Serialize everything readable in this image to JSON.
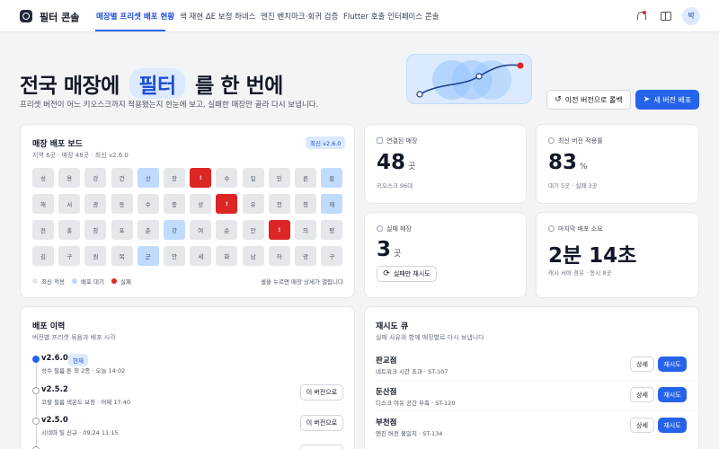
{
  "app": {
    "title": "필터 콘솔"
  },
  "nav": {
    "tabs": [
      {
        "label": "매장별 프리셋 배포 현황"
      },
      {
        "label": "색 재현 ΔE 보정 하네스"
      },
      {
        "label": "엔진 벤치마크·회귀 검증"
      },
      {
        "label": "Flutter 호출 인터페이스 콘솔"
      }
    ],
    "active_tab": 0,
    "avatar": "박"
  },
  "hero": {
    "title_before": "전국 매장에",
    "title_highlight": "필터",
    "title_after": "를 한 번에",
    "subtitle": "프리셋 버전이 어느 키오스크까지 적용됐는지 한눈에 보고, 실패한 매장만 골라 다시 보냅니다.",
    "rollback_label": "이전 버전으로 롤백",
    "deploy_label": "새 버전 배포"
  },
  "board": {
    "title": "매장 배포 보드",
    "badge": "최신 v2.6.0",
    "subtitle": "지역 6곳 · 매장 48곳 · 최신 v2.6.0",
    "rows": [
      [
        {
          "t": "성",
          "s": "latest"
        },
        {
          "t": "용",
          "s": "latest"
        },
        {
          "t": "강",
          "s": "latest"
        },
        {
          "t": "건",
          "s": "latest"
        },
        {
          "t": "산",
          "s": "waiting"
        },
        {
          "t": "장",
          "s": "latest"
        },
        {
          "t": "!",
          "s": "failed"
        },
        {
          "t": "수",
          "s": "latest"
        },
        {
          "t": "일",
          "s": "latest"
        },
        {
          "t": "인",
          "s": "latest"
        },
        {
          "t": "론",
          "s": "latest"
        },
        {
          "t": "릉",
          "s": "waiting"
        }
      ],
      [
        {
          "t": "해",
          "s": "latest"
        },
        {
          "t": "서",
          "s": "latest"
        },
        {
          "t": "광",
          "s": "latest"
        },
        {
          "t": "동",
          "s": "latest"
        },
        {
          "t": "수",
          "s": "latest"
        },
        {
          "t": "충",
          "s": "latest"
        },
        {
          "t": "상",
          "s": "latest"
        },
        {
          "t": "!",
          "s": "failed"
        },
        {
          "t": "유",
          "s": "latest"
        },
        {
          "t": "천",
          "s": "latest"
        },
        {
          "t": "청",
          "s": "latest"
        },
        {
          "t": "제",
          "s": "waiting"
        }
      ],
      [
        {
          "t": "전",
          "s": "latest"
        },
        {
          "t": "홍",
          "s": "latest"
        },
        {
          "t": "창",
          "s": "latest"
        },
        {
          "t": "포",
          "s": "latest"
        },
        {
          "t": "춘",
          "s": "latest"
        },
        {
          "t": "강",
          "s": "waiting"
        },
        {
          "t": "여",
          "s": "latest"
        },
        {
          "t": "순",
          "s": "latest"
        },
        {
          "t": "안",
          "s": "latest"
        },
        {
          "t": "!",
          "s": "failed"
        },
        {
          "t": "의",
          "s": "latest"
        },
        {
          "t": "평",
          "s": "latest"
        }
      ],
      [
        {
          "t": "김",
          "s": "latest"
        },
        {
          "t": "구",
          "s": "latest"
        },
        {
          "t": "원",
          "s": "latest"
        },
        {
          "t": "목",
          "s": "latest"
        },
        {
          "t": "군",
          "s": "waiting"
        },
        {
          "t": "안",
          "s": "latest"
        },
        {
          "t": "세",
          "s": "latest"
        },
        {
          "t": "화",
          "s": "latest"
        },
        {
          "t": "남",
          "s": "latest"
        },
        {
          "t": "하",
          "s": "latest"
        },
        {
          "t": "광",
          "s": "latest"
        },
        {
          "t": "구",
          "s": "latest"
        }
      ]
    ],
    "legend": {
      "latest": "최신 적용",
      "waiting": "배포 대기",
      "failed": "실패"
    },
    "hint": "셀을 누르면 매장 상세가 열립니다",
    "colors": {
      "latest": "#e5e7eb",
      "waiting": "#bfdbfe",
      "failed": "#dc2626"
    }
  },
  "stats": {
    "connected": {
      "label": "연결된 매장",
      "value": "48",
      "unit": "곳",
      "note": "키오스크 96대"
    },
    "latest_rate": {
      "label": "최신 버전 적용률",
      "value": "83",
      "unit": "%",
      "note": "대기 5곳 · 실패 3곳"
    },
    "failed": {
      "label": "실패 매장",
      "value": "3",
      "unit": "곳",
      "retry_label": "실패만 재시도"
    },
    "duration": {
      "label": "마지막 배포 소요",
      "value": "2분 14초",
      "note": "캐시 서버 경유 · 동시 8곳"
    }
  },
  "history": {
    "title": "배포 이력",
    "subtitle": "버전별 프리셋 묶음과 배포 시각",
    "items": [
      {
        "version": "v2.6.0",
        "badge": "현재",
        "note": "성수 필름 톤 외 2종 · 오늘 14:02"
      },
      {
        "version": "v2.5.2",
        "note": "코랄 필름 색온도 보정 · 어제 17:40",
        "action": "이 버전으로"
      },
      {
        "version": "v2.5.0",
        "note": "시네마 틸 신규 · 09.24 11:15",
        "action": "이 버전으로"
      }
    ]
  },
  "queue": {
    "title": "재시도 큐",
    "subtitle": "실패 사유와 함께 매장별로 다시 보냅니다",
    "detail_label": "상세",
    "retry_label": "재시도",
    "items": [
      {
        "name": "판교점",
        "reason": "네트워크 시간 초과 · ST-107"
      },
      {
        "name": "둔산점",
        "reason": "디스크 여유 공간 부족 · ST-120"
      },
      {
        "name": "부천점",
        "reason": "엔진 버전 불일치 · ST-134"
      }
    ]
  },
  "accent": "#2563eb"
}
